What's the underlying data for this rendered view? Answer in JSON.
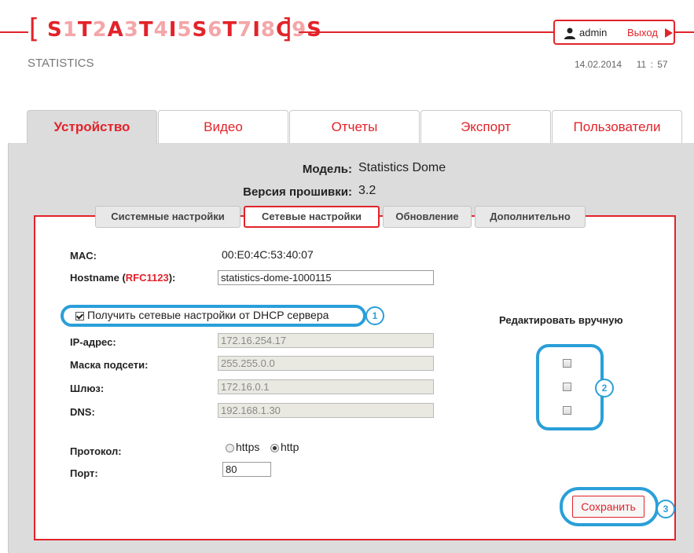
{
  "header": {
    "logo_chars": [
      "S",
      "1",
      "T",
      "2",
      "A",
      "3",
      "T",
      "4",
      "I",
      "5",
      "S",
      "6",
      "T",
      "7",
      "I",
      "8",
      "C",
      "9",
      "S"
    ],
    "bracket_left": "[",
    "bracket_right": "]",
    "subtitle": "STATISTICS",
    "user": "admin",
    "logout": "Выход",
    "date": "14.02.2014",
    "time_hours": "11",
    "time_sep": ":",
    "time_minutes": "57"
  },
  "tabs": [
    "Устройство",
    "Видео",
    "Отчеты",
    "Экспорт",
    "Пользователи"
  ],
  "active_tab": "Устройство",
  "device": {
    "model_label": "Модель:",
    "model_value": "Statistics Dome",
    "firmware_label": "Версия прошивки:",
    "firmware_value": "3.2"
  },
  "subtabs": [
    "Системные настройки",
    "Сетевые настройки",
    "Обновление",
    "Дополнительно"
  ],
  "active_subtab": "Сетевые настройки",
  "network": {
    "mac_label": "MAC:",
    "mac_value": "00:E0:4C:53:40:07",
    "hostname_label": "Hostname (",
    "hostname_link": "RFC1123",
    "hostname_suffix": "):",
    "hostname_value": "statistics-dome-1000115",
    "dhcp_label": "Получить сетевые настройки от DHCP сервера",
    "dhcp_checked": true,
    "manual_edit_label": "Редактировать вручную",
    "ip_label": "IP-адрес:",
    "ip_value": "172.16.254.17",
    "mask_label": "Маска подсети:",
    "mask_value": "255.255.0.0",
    "gateway_label": "Шлюз:",
    "gateway_value": "172.16.0.1",
    "dns_label": "DNS:",
    "dns_value": "192.168.1.30",
    "protocol_label": "Протокол:",
    "protocol_options": [
      "https",
      "http"
    ],
    "protocol_selected": "http",
    "port_label": "Порт:",
    "port_value": "80",
    "save_label": "Сохранить"
  },
  "callouts": [
    "1",
    "2",
    "3"
  ],
  "colors": {
    "accent": "#e2232a",
    "callout": "#2a9fd8",
    "panel": "#dcdcdc"
  }
}
